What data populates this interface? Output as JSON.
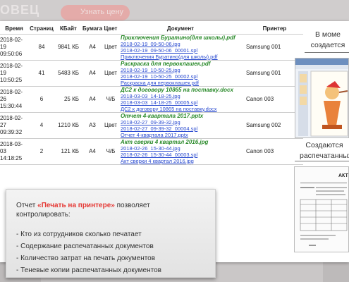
{
  "background": {
    "title_fragment": "ОВЕЦ",
    "pill_label": "Узнать цену"
  },
  "table": {
    "headers": {
      "time": "Время",
      "pages": "Страниц",
      "kb": "КБайт",
      "paper": "Бумага",
      "color": "Цвет",
      "document": "Документ",
      "printer": "Принтер"
    },
    "rows": [
      {
        "date": "2018-02-19",
        "time": "09:50:06",
        "pages": "84",
        "kb": "9841 КБ",
        "paper": "A4",
        "color": "Цвет",
        "title": "Приключения Буратино(для школы).pdf",
        "links": [
          "2018-02-19_09-50-06.jpg",
          "2018-02-19_09-50-06_00001.spl",
          "Приключения Буратино(для школы).pdf"
        ],
        "printer": "Samsung 001"
      },
      {
        "date": "2018-02-19",
        "time": "10:50:25",
        "pages": "41",
        "kb": "5483 КБ",
        "paper": "A4",
        "color": "Цвет",
        "title": "Раскраска для первоклашек.pdf",
        "links": [
          "2018-02-19_10-50-25.jpg",
          "2018-02-19_10-50-25_00002.spl",
          "Раскраска для первоклашек.pdf"
        ],
        "printer": "Samsung 001"
      },
      {
        "date": "2018-02-26",
        "time": "15:30:44",
        "pages": "6",
        "kb": "25 КБ",
        "paper": "A4",
        "color": "Ч/Б",
        "title": "ДС2 к договору 10865 на поставку.docx",
        "links": [
          "2018-03-03_14-18-25.jpg",
          "2018-03-03_14-18-25_00005.spl",
          "ДС2 к договору 10865 на поставку.docx"
        ],
        "printer": "Canon 003"
      },
      {
        "date": "2018-02-27",
        "time": "09:39:32",
        "pages": "4",
        "kb": "1210 КБ",
        "paper": "A3",
        "color": "Цвет",
        "title": "Отчет 4-квартала 2017.pptx",
        "links": [
          "2018-02-27_09-39-32.jpg",
          "2018-02-27_09-39-32_00004.spl",
          "Отчет 4-квартала 2017.pptx"
        ],
        "printer": "Samsung 002"
      },
      {
        "date": "2018-03-03",
        "time": "14:18:25",
        "pages": "2",
        "kb": "121 КБ",
        "paper": "A4",
        "color": "Ч/Б",
        "title": "Акт сверки 4 квартал 2016.jpg",
        "links": [
          "2018-02-26_15-30-44.jpg",
          "2018-02-26_15-30-44_00003.spl",
          "Акт сверки 4 квартал 2016.jpg"
        ],
        "printer": "Canon 003"
      }
    ]
  },
  "notes": {
    "note1_line1": "В моме",
    "note1_line2": "создается",
    "note2_line1": "Создаются",
    "note2_line2": "распечатанных до"
  },
  "preview": {
    "act_title": "АКТ №"
  },
  "info": {
    "lead_before": "Отчет ",
    "lead_accent": "«Печать на принтере»",
    "lead_after": " позволяет контролировать:",
    "items": [
      "- Кто из сотрудников сколько печатает",
      "- Содержание распечатанных документов",
      "- Количество затрат на печать документов",
      "- Теневые копии распечатанных документов"
    ]
  },
  "colors": {
    "accent": "#e53935",
    "doc_title": "#2a8a2a",
    "link": "#2a4bd0"
  }
}
